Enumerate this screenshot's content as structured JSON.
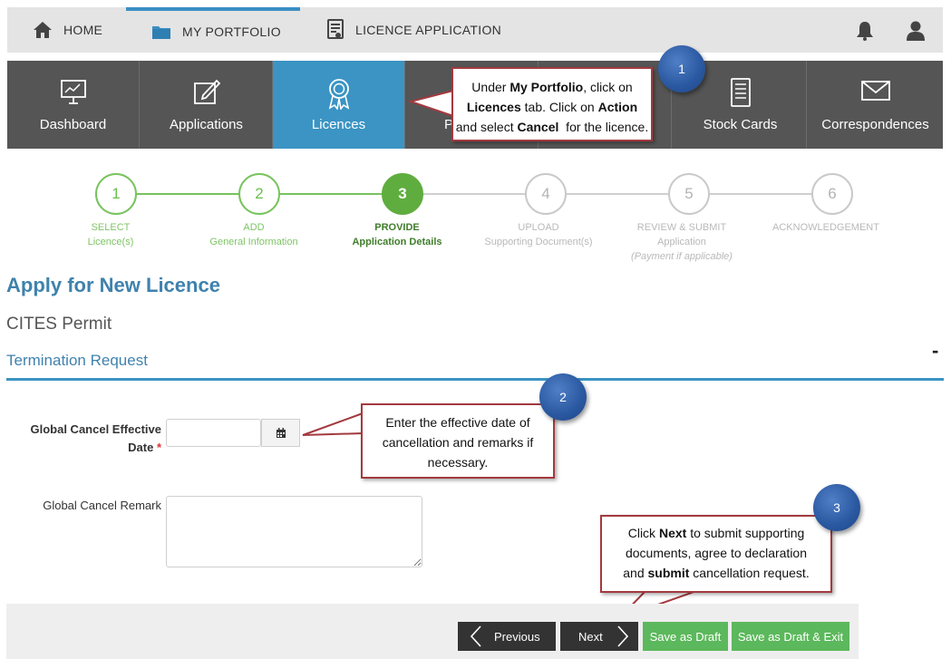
{
  "topnav": {
    "home": "HOME",
    "portfolio": "MY PORTFOLIO",
    "licence_application": "LICENCE APPLICATION"
  },
  "modules": [
    {
      "label": "Dashboard",
      "icon": "presentation-chart-icon"
    },
    {
      "label": "Applications",
      "icon": "edit-document-icon"
    },
    {
      "label": "Licences",
      "icon": "award-ribbon-icon"
    },
    {
      "label": "P",
      "icon": "hidden"
    },
    {
      "label": "",
      "icon": "hidden"
    },
    {
      "label": "Stock Cards",
      "icon": "stock-card-icon"
    },
    {
      "label": "Correspondences",
      "icon": "envelope-icon"
    }
  ],
  "callouts": {
    "c1": {
      "number": "1"
    },
    "c2": {
      "number": "2",
      "text": "Enter the effective date of cancellation and remarks if necessary."
    },
    "c3": {
      "number": "3"
    }
  },
  "steps": [
    {
      "number": "1",
      "line1": "SELECT",
      "line2": "Licence(s)",
      "line3": ""
    },
    {
      "number": "2",
      "line1": "ADD",
      "line2": "General Information",
      "line3": ""
    },
    {
      "number": "3",
      "line1": "PROVIDE",
      "line2": "Application Details",
      "line3": ""
    },
    {
      "number": "4",
      "line1": "UPLOAD",
      "line2": "Supporting Document(s)",
      "line3": ""
    },
    {
      "number": "5",
      "line1": "REVIEW & SUBMIT",
      "line2": "Application",
      "line3": "(Payment if applicable)"
    },
    {
      "number": "6",
      "line1": "ACKNOWLEDGEMENT",
      "line2": "",
      "line3": ""
    }
  ],
  "page": {
    "title": "Apply for New Licence",
    "subtitle": "CITES Permit",
    "section": "Termination Request",
    "collapse": "-"
  },
  "form": {
    "effective_date_label_line1": "Global Cancel Effective",
    "effective_date_label_line2": "Date",
    "required_mark": "*",
    "remark_label": "Global Cancel Remark",
    "effective_date_value": "",
    "remark_value": ""
  },
  "buttons": {
    "previous": "Previous",
    "next": "Next",
    "save_draft": "Save as Draft",
    "save_draft_exit": "Save as Draft & Exit"
  },
  "colors": {
    "accent": "#3b94c4",
    "success": "#5cb85c",
    "callout_border": "#a33a3f",
    "badge": "#2a58a0"
  }
}
